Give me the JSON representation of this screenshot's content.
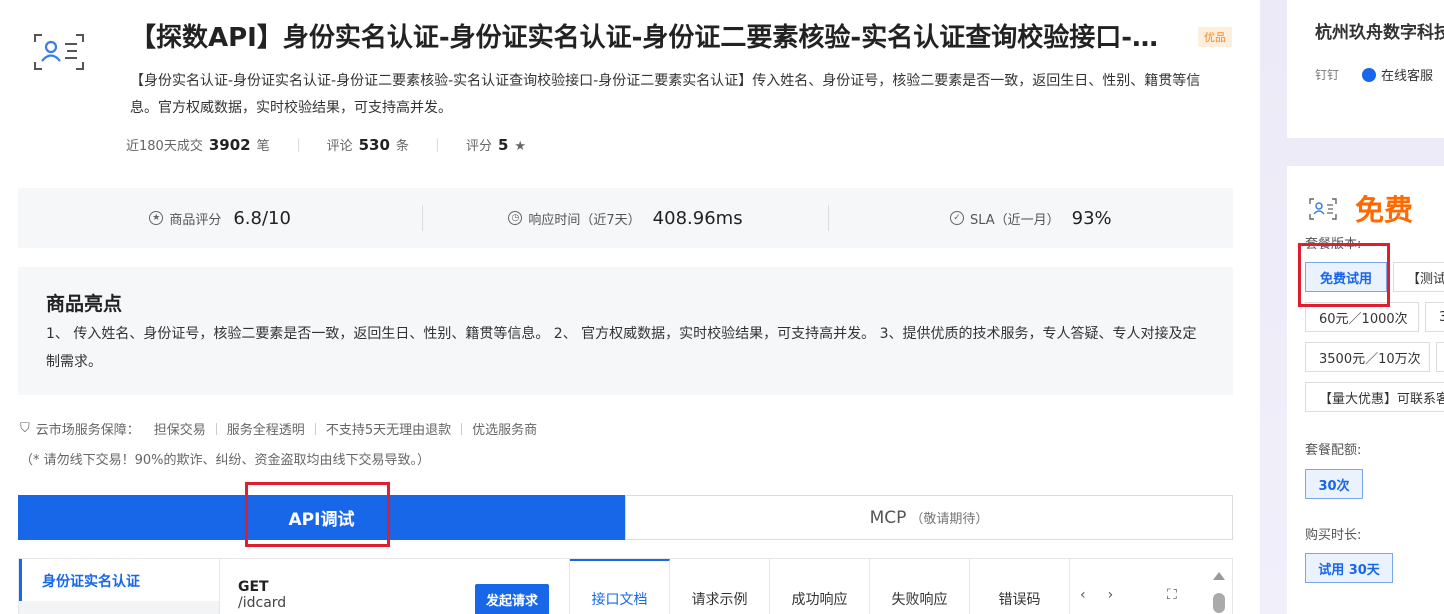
{
  "product": {
    "title": "【探数API】身份实名认证-身份证实名认证-身份证二要素核验-实名认证查询校验接口-身份证二要素实名认证",
    "badge": "优品",
    "description": "【身份实名认证-身份证实名认证-身份证二要素核验-实名认证查询校验接口-身份证二要素实名认证】传入姓名、身份证号，核验二要素是否一致，返回生日、性别、籍贯等信息。官方权威数据，实时校验结果，可支持高并发。",
    "icon": "id-card-icon"
  },
  "stats": [
    {
      "label": "近180天成交",
      "value": "3902",
      "unit": "笔"
    },
    {
      "label": "评论",
      "value": "530",
      "unit": "条"
    },
    {
      "label": "评分",
      "value": "5",
      "unit": "★"
    }
  ],
  "metrics": [
    {
      "icon": "star-circle-icon",
      "label": "商品评分",
      "value": "6.8/10"
    },
    {
      "icon": "clock-icon",
      "label": "响应时间（近7天）",
      "value": "408.96ms"
    },
    {
      "icon": "check-circle-icon",
      "label": "SLA（近一月）",
      "value": "93%"
    }
  ],
  "highlights": {
    "title": "商品亮点",
    "text": "1、 传入姓名、身份证号，核验二要素是否一致，返回生日、性别、籍贯等信息。 2、 官方权威数据，实时校验结果，可支持高并发。 3、提供优质的技术服务，专人答疑、专人对接及定制需求。"
  },
  "guarantee": {
    "label": "云市场服务保障：",
    "items": [
      "担保交易",
      "服务全程透明",
      "不支持5天无理由退款",
      "优选服务商"
    ],
    "warning": "（* 请勿线下交易！90%的欺诈、纠纷、资金盗取均由线下交易导致。）"
  },
  "tabs": {
    "api": "API调试",
    "mcp": "MCP",
    "mcp_note": "（敬请期待）"
  },
  "api_panel": {
    "nav_item": "身份证实名认证",
    "method": "GET",
    "path": "/idcard",
    "send_button": "发起请求",
    "doc_tabs": [
      "接口文档",
      "请求示例",
      "成功响应",
      "失败响应",
      "错误码"
    ]
  },
  "seller": {
    "name": "杭州玖舟数字科技",
    "dingtalk": "钉钉",
    "customer_service": "在线客服"
  },
  "purchase": {
    "price": "免费",
    "version_label": "套餐版本:",
    "versions": [
      "免费试用",
      "【测试",
      "60元／1000次",
      "3",
      "3500元／10万次",
      "",
      "【量大优惠】可联系客"
    ],
    "quota_label": "套餐配额:",
    "quota": "30次",
    "duration_label": "购买时长:",
    "duration": "试用 30天"
  },
  "colors": {
    "primary": "#1767e8",
    "price": "#ff6a00",
    "highlight_box": "#e01e2e"
  }
}
